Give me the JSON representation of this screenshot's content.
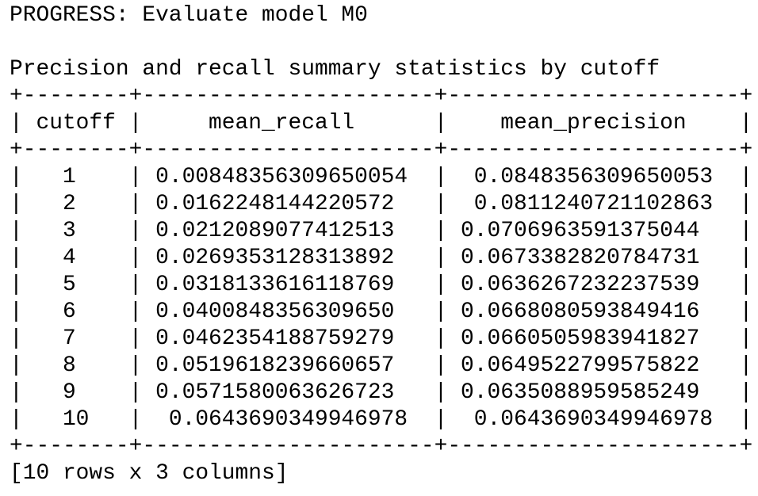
{
  "progress_line": "PROGRESS: Evaluate model M0",
  "blank": "",
  "caption": "Precision and recall summary statistics by cutoff",
  "table": {
    "border_top": "+--------+----------------------+----------------------+",
    "header_row": "| cutoff |     mean_recall      |    mean_precision    |",
    "header_sep": "+--------+----------------------+----------------------+",
    "rows": [
      "|   1    | 0.00848356309650054  |  0.0848356309650053  |",
      "|   2    | 0.0162248144220572   |  0.0811240721102863  |",
      "|   3    | 0.0212089077412513   | 0.0706963591375044   |",
      "|   4    | 0.0269353128313892   | 0.0673382820784731   |",
      "|   5    | 0.0318133616118769   | 0.0636267232237539   |",
      "|   6    | 0.0400848356309650   | 0.0668080593849416   |",
      "|   7    | 0.0462354188759279   | 0.0660505983941827   |",
      "|   8    | 0.0519618239660657   | 0.0649522799575822   |",
      "|   9    | 0.0571580063626723   | 0.0635088959585249   |",
      "|   10   |  0.0643690349946978  |  0.0643690349946978  |"
    ],
    "border_bottom": "+--------+----------------------+----------------------+",
    "columns": [
      "cutoff",
      "mean_recall",
      "mean_precision"
    ],
    "values": [
      [
        "1",
        "0.00848356309650054",
        "0.0848356309650053"
      ],
      [
        "2",
        "0.0162248144220572",
        "0.0811240721102863"
      ],
      [
        "3",
        "0.0212089077412513",
        "0.0706963591375044"
      ],
      [
        "4",
        "0.0269353128313892",
        "0.0673382820784731"
      ],
      [
        "5",
        "0.0318133616118769",
        "0.0636267232237539"
      ],
      [
        "6",
        "0.0400848356309650",
        "0.0668080593849416"
      ],
      [
        "7",
        "0.0462354188759279",
        "0.0660505983941827"
      ],
      [
        "8",
        "0.0519618239660657",
        "0.0649522799575822"
      ],
      [
        "9",
        "0.0571580063626723",
        "0.0635088959585249"
      ],
      [
        "10",
        "0.0643690349946978",
        "0.0643690349946978"
      ]
    ]
  },
  "footer": "[10 rows x 3 columns]"
}
